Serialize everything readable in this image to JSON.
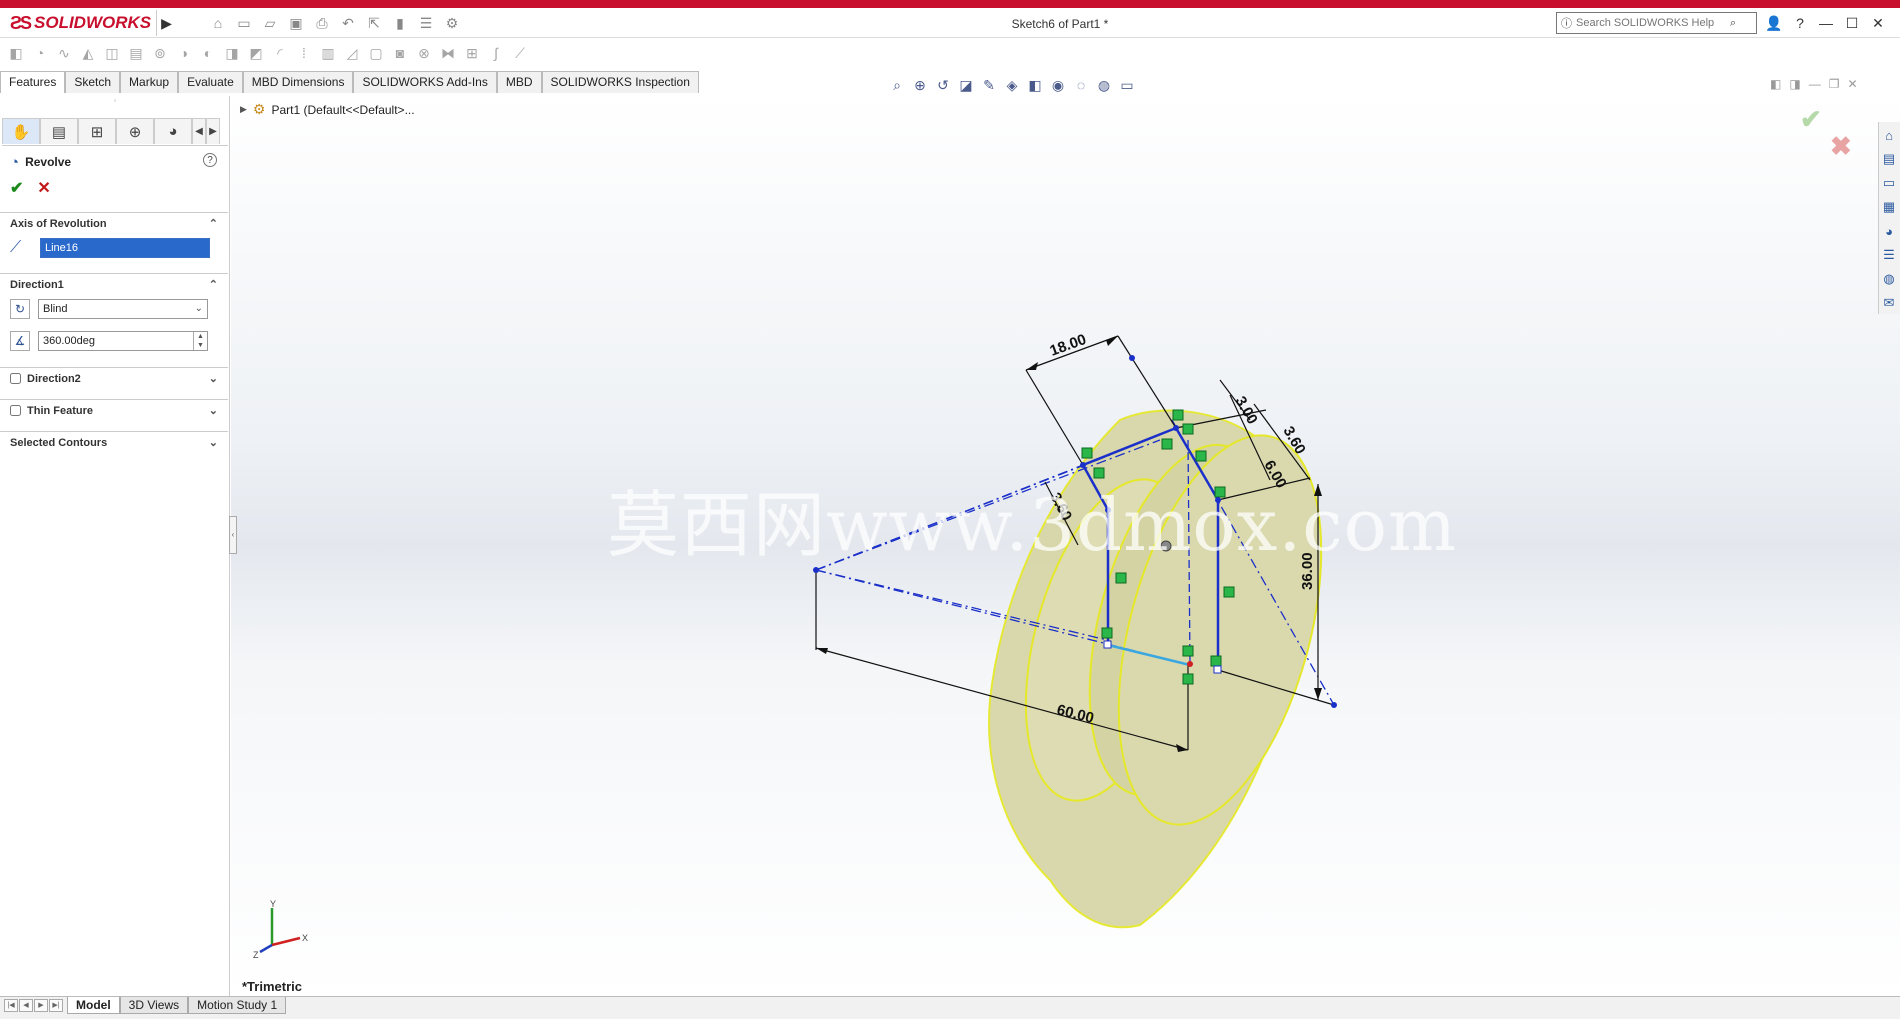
{
  "app": {
    "brand": "SOLIDWORKS",
    "document_title": "Sketch6 of Part1 *",
    "search_placeholder": "Search SOLIDWORKS Help"
  },
  "command_tabs": [
    {
      "label": "Features",
      "active": true
    },
    {
      "label": "Sketch",
      "active": false
    },
    {
      "label": "Markup",
      "active": false
    },
    {
      "label": "Evaluate",
      "active": false
    },
    {
      "label": "MBD Dimensions",
      "active": false
    },
    {
      "label": "SOLIDWORKS Add-Ins",
      "active": false
    },
    {
      "label": "MBD",
      "active": false
    },
    {
      "label": "SOLIDWORKS Inspection",
      "active": false
    }
  ],
  "feature_tree": {
    "root_label": "Part1  (Default<<Default>..."
  },
  "property_manager": {
    "title": "Revolve",
    "help_icon": "help-icon",
    "axis_group": {
      "label": "Axis of Revolution",
      "value": "Line16"
    },
    "direction1": {
      "label": "Direction1",
      "type_value": "Blind",
      "angle_value": "360.00deg"
    },
    "direction2": {
      "label": "Direction2",
      "checked": false
    },
    "thin_feature": {
      "label": "Thin Feature",
      "checked": false
    },
    "selected_contours": {
      "label": "Selected Contours"
    }
  },
  "viewport": {
    "watermark": "莫西网www.3dmox.com",
    "view_name": "*Trimetric",
    "dimensions": [
      "18.00",
      "3.00",
      "3.60",
      "6.00",
      "36.00",
      "60.00",
      "3.60"
    ],
    "triad_labels": {
      "x": "X",
      "y": "Y",
      "z": "Z"
    }
  },
  "bottom_tabs": [
    {
      "label": "Model",
      "active": true
    },
    {
      "label": "3D Views",
      "active": false
    },
    {
      "label": "Motion Study 1",
      "active": false
    }
  ],
  "colors": {
    "brand_red": "#c8102e",
    "sketch_blue": "#1b2fc9",
    "preview_fill": "#d7d6a8",
    "preview_edge": "#e8ea2a"
  }
}
